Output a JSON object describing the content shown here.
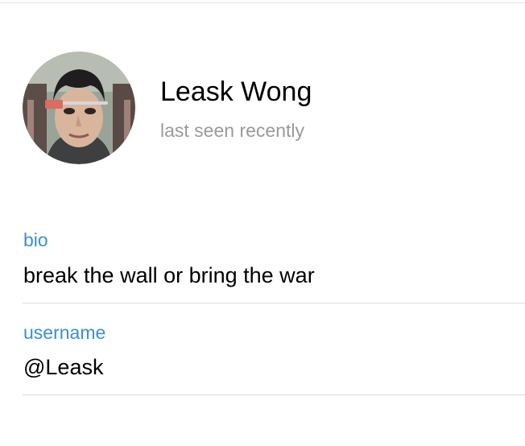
{
  "profile": {
    "name": "Leask Wong",
    "status": "last seen recently",
    "avatar_icon": "user-photo-avatar"
  },
  "info": {
    "bio": {
      "label": "bio",
      "value": "break the wall or bring the war"
    },
    "username": {
      "label": "username",
      "value": "@Leask"
    }
  },
  "colors": {
    "label_accent": "#3d8fd1",
    "status_gray": "#9a9a9a",
    "divider": "#dcdcdc"
  }
}
